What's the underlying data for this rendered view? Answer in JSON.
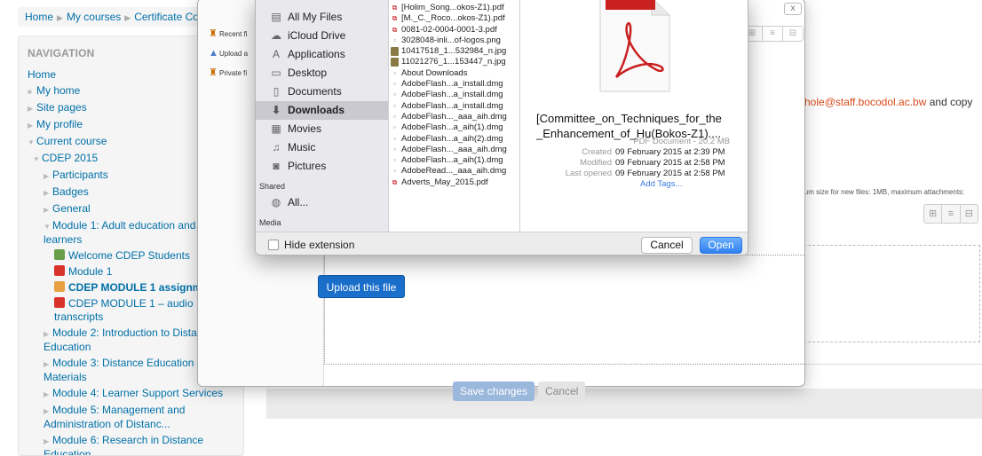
{
  "breadcrumb": [
    "Home",
    "My courses",
    "Certificate Co"
  ],
  "navigation": {
    "title": "NAVIGATION",
    "home": "Home",
    "my_home": "My home",
    "site_pages": "Site pages",
    "my_profile": "My profile",
    "current_course": "Current course",
    "course_code": "CDEP 2015",
    "participants": "Participants",
    "badges": "Badges",
    "general": "General",
    "module1": "Module 1: Adult education and learners",
    "welcome": "Welcome CDEP Students",
    "module1_item": "Module 1",
    "assignment": "CDEP MODULE 1 assignm 2015",
    "audio": "CDEP MODULE 1 – audio transcripts",
    "module2": "Module 2: Introduction to Dista Education",
    "module3": "Module 3: Distance Education Materials",
    "module4": "Module 4: Learner Support Services",
    "module5": "Module 5: Management and Administration of Distanc...",
    "module6": "Module 6: Research in Distance Education"
  },
  "background": {
    "email_text": "hole@staff.bocodol.ac.bw",
    "email_suffix": " and copy",
    "limits_hint": "ium size for new files: 1MB, maximum attachments:",
    "view_icons": [
      "⊞",
      "≡",
      "⊟"
    ]
  },
  "picker": {
    "repos": [
      "Recent fi",
      "Upload a",
      "Private fi"
    ],
    "close": "x",
    "view_icons": [
      "⊞",
      "≡",
      "⊟"
    ],
    "upload_button": "Upload this file",
    "save_button": "Save changes",
    "cancel_button": "Cancel"
  },
  "dialog": {
    "favorites": [
      {
        "label": "All My Files",
        "icon": "▤"
      },
      {
        "label": "iCloud Drive",
        "icon": "☁"
      },
      {
        "label": "Applications",
        "icon": "A"
      },
      {
        "label": "Desktop",
        "icon": "▭"
      },
      {
        "label": "Documents",
        "icon": "▯"
      },
      {
        "label": "Downloads",
        "icon": "⬇"
      },
      {
        "label": "Movies",
        "icon": "▦"
      },
      {
        "label": "Music",
        "icon": "♫"
      },
      {
        "label": "Pictures",
        "icon": "◙"
      }
    ],
    "shared_header": "Shared",
    "shared_all": "All...",
    "media_header": "Media",
    "files": [
      {
        "name": "[Holim_Song...okos-Z1).pdf",
        "type": "pdf"
      },
      {
        "name": "[M._C._Roco...okos-Z1).pdf",
        "type": "pdf"
      },
      {
        "name": "0081-02-0004-0001-3.pdf",
        "type": "pdf"
      },
      {
        "name": "3028048-inli...of-logos.png",
        "type": "doc"
      },
      {
        "name": "10417518_1...532984_n.jpg",
        "type": "img"
      },
      {
        "name": "11021276_1...153447_n.jpg",
        "type": "img"
      },
      {
        "name": "About Downloads",
        "type": "doc"
      },
      {
        "name": "AdobeFlash...a_install.dmg",
        "type": "doc"
      },
      {
        "name": "AdobeFlash...a_install.dmg",
        "type": "doc"
      },
      {
        "name": "AdobeFlash...a_install.dmg",
        "type": "doc"
      },
      {
        "name": "AdobeFlash..._aaa_aih.dmg",
        "type": "doc"
      },
      {
        "name": "AdobeFlash...a_aih(1).dmg",
        "type": "doc"
      },
      {
        "name": "AdobeFlash...a_aih(2).dmg",
        "type": "doc"
      },
      {
        "name": "AdobeFlash..._aaa_aih.dmg",
        "type": "doc"
      },
      {
        "name": "AdobeFlash...a_aih(1).dmg",
        "type": "doc"
      },
      {
        "name": "AdobeRead..._aaa_aih.dmg",
        "type": "doc"
      },
      {
        "name": "Adverts_May_2015.pdf",
        "type": "pdf"
      }
    ],
    "preview": {
      "title_line1": "[Committee_on_Techniques_for_the",
      "title_line2": "_Enhancement_of_Hu(Bokos-Z1)....",
      "kind": "PDF Document - 20.2 MB",
      "labels": [
        "Created",
        "Modified",
        "Last opened"
      ],
      "values": [
        "09 February 2015 at 2:39 PM",
        "09 February 2015 at 2:58 PM",
        "09 February 2015 at 2:58 PM"
      ],
      "add_tags": "Add Tags..."
    },
    "hide_extension": "Hide extension",
    "cancel": "Cancel",
    "open": "Open"
  }
}
